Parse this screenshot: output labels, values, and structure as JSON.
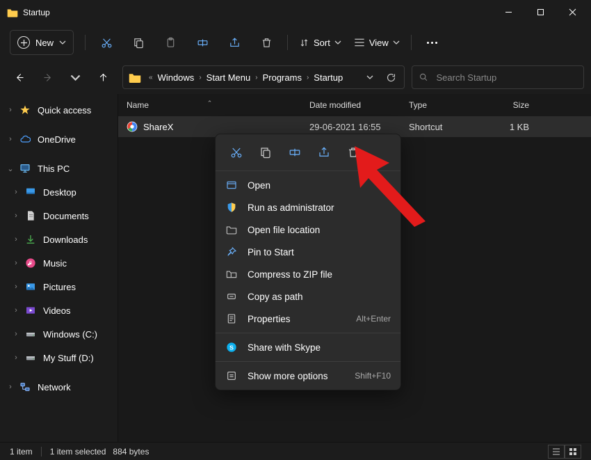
{
  "window": {
    "title": "Startup"
  },
  "toolbar": {
    "new_label": "New",
    "sort_label": "Sort",
    "view_label": "View"
  },
  "breadcrumbs": [
    "Windows",
    "Start Menu",
    "Programs",
    "Startup"
  ],
  "search": {
    "placeholder": "Search Startup"
  },
  "columns": {
    "name": "Name",
    "date": "Date modified",
    "type": "Type",
    "size": "Size"
  },
  "sidebar": {
    "items": [
      {
        "label": "Quick access",
        "icon": "star",
        "expand": "right"
      },
      {
        "label": "OneDrive",
        "icon": "cloud",
        "expand": "right"
      },
      {
        "label": "This PC",
        "icon": "pc",
        "expand": "down"
      },
      {
        "label": "Desktop",
        "icon": "desktop",
        "sub": true,
        "expand": "right"
      },
      {
        "label": "Documents",
        "icon": "documents",
        "sub": true,
        "expand": "right"
      },
      {
        "label": "Downloads",
        "icon": "downloads",
        "sub": true,
        "expand": "right"
      },
      {
        "label": "Music",
        "icon": "music",
        "sub": true,
        "expand": "right"
      },
      {
        "label": "Pictures",
        "icon": "pictures",
        "sub": true,
        "expand": "right"
      },
      {
        "label": "Videos",
        "icon": "videos",
        "sub": true,
        "expand": "right"
      },
      {
        "label": "Windows (C:)",
        "icon": "drive",
        "sub": true,
        "expand": "right"
      },
      {
        "label": "My Stuff (D:)",
        "icon": "drive",
        "sub": true,
        "expand": "right"
      },
      {
        "label": "Network",
        "icon": "network",
        "expand": "right"
      }
    ]
  },
  "rows": [
    {
      "name": "ShareX",
      "date": "29-06-2021 16:55",
      "type": "Shortcut",
      "size": "1 KB"
    }
  ],
  "context_menu": {
    "items": [
      {
        "label": "Open",
        "icon": "open"
      },
      {
        "label": "Run as administrator",
        "icon": "shield"
      },
      {
        "label": "Open file location",
        "icon": "folder"
      },
      {
        "label": "Pin to Start",
        "icon": "pin"
      },
      {
        "label": "Compress to ZIP file",
        "icon": "zip"
      },
      {
        "label": "Copy as path",
        "icon": "path"
      },
      {
        "label": "Properties",
        "icon": "props",
        "shortcut": "Alt+Enter"
      }
    ],
    "skype": {
      "label": "Share with Skype",
      "icon": "skype"
    },
    "more": {
      "label": "Show more options",
      "shortcut": "Shift+F10"
    }
  },
  "status": {
    "items_count": "1 item",
    "selected": "1 item selected",
    "size": "884 bytes"
  }
}
